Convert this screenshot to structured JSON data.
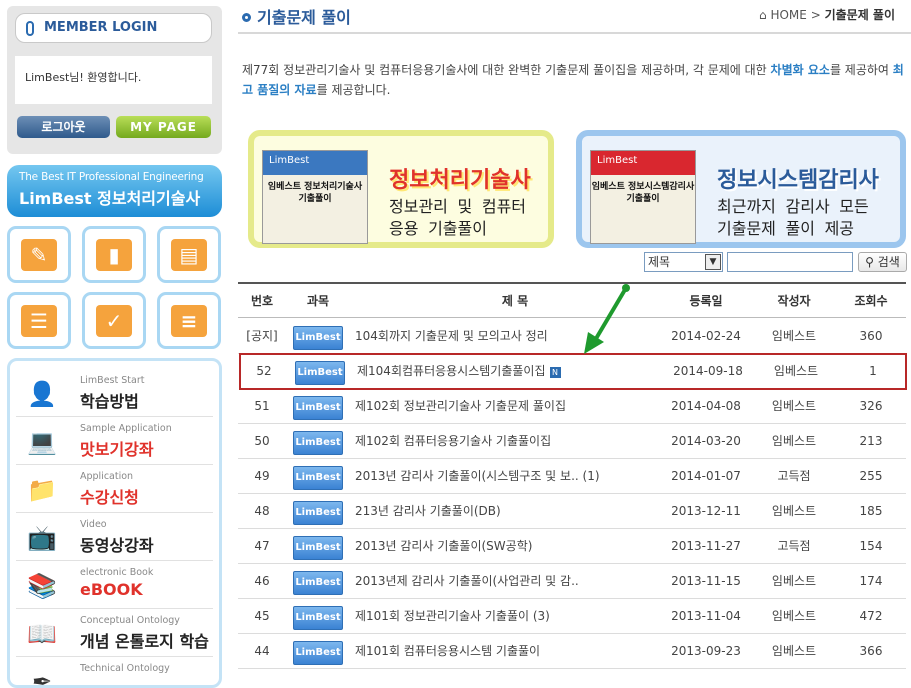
{
  "sidebar": {
    "login_title": "MEMBER LOGIN",
    "welcome": "LimBest님! 환영합니다.",
    "logout_label": "로그아웃",
    "mypage_label": "MY PAGE",
    "banner_sub": "The Best IT Professional Engineering",
    "banner_main": "LimBest 정보처리기술사",
    "tiles": [
      "pencil-icon",
      "chart-icon",
      "book-icon",
      "list-icon",
      "check-icon",
      "menu-list-icon"
    ],
    "menu": [
      {
        "sub": "LimBest Start",
        "main": "학습방법",
        "red": false,
        "icon": "person-icon"
      },
      {
        "sub": "Sample Application",
        "main": "맛보기강좌",
        "red": true,
        "icon": "laptop-icon"
      },
      {
        "sub": "Application",
        "main": "수강신청",
        "red": true,
        "icon": "folder-icon"
      },
      {
        "sub": "Video",
        "main": "동영상강좌",
        "red": false,
        "icon": "tv-icon"
      },
      {
        "sub": "electronic Book",
        "main": "eBOOK",
        "red": true,
        "icon": "books-icon"
      },
      {
        "sub": "Conceptual Ontology",
        "main": "개념 온톨로지 학습",
        "red": false,
        "icon": "open-book-icon"
      },
      {
        "sub": "Technical Ontology",
        "main": "",
        "red": false,
        "icon": "pen-icon"
      }
    ]
  },
  "header": {
    "title": "기출문제 풀이",
    "crumb_home": "HOME",
    "crumb_sep": ">",
    "crumb_current": "기출문제 풀이"
  },
  "intro": {
    "part1": "제77회 정보관리기술사 및 컴퓨터응용기술사에 대한 완벽한 기출문제 풀이집을 제공하며, 각 문제에 대한 ",
    "hl1": "차별화 요소",
    "part2": "를 제공하여 ",
    "hl2": "최고 품질의 자료",
    "part3": "를 제공합니다."
  },
  "promos": [
    {
      "title": "정보처리기술사",
      "desc1": "정보관리 및 컴퓨터",
      "desc2": "응용 기출풀이",
      "book_head": "LimBest",
      "book_title": "임베스트 정보처리기술사 기출풀이"
    },
    {
      "title": "정보시스템감리사",
      "desc1": "최근까지 감리사 모든",
      "desc2": "기출문제 풀이 제공",
      "book_head": "LimBest",
      "book_title": "임베스트 정보시스템감리사 기출풀이"
    }
  ],
  "search": {
    "field": "제목",
    "button": "검색"
  },
  "table": {
    "headers": {
      "no": "번호",
      "cat": "과목",
      "title": "제 목",
      "date": "등록일",
      "writer": "작성자",
      "views": "조회수"
    },
    "rows": [
      {
        "no": "[공지]",
        "cat": "LimBest",
        "title": "104회까지 기출문제 및 모의고사 정리",
        "date": "2014-02-24",
        "writer": "임베스트",
        "views": "360",
        "new": false
      },
      {
        "no": "52",
        "cat": "LimBest",
        "title": "제104회컴퓨터응용시스템기출풀이집",
        "date": "2014-09-18",
        "writer": "임베스트",
        "views": "1",
        "new": true,
        "new_label": "N"
      },
      {
        "no": "51",
        "cat": "LimBest",
        "title": "제102회 정보관리기술사 기출문제 풀이집",
        "date": "2014-04-08",
        "writer": "임베스트",
        "views": "326",
        "new": false
      },
      {
        "no": "50",
        "cat": "LimBest",
        "title": "제102회 컴퓨터응용기술사 기출풀이집",
        "date": "2014-03-20",
        "writer": "임베스트",
        "views": "213",
        "new": false
      },
      {
        "no": "49",
        "cat": "LimBest",
        "title": "2013년 감리사 기출풀이(시스템구조 및 보.. (1)",
        "date": "2014-01-07",
        "writer": "고득점",
        "views": "255",
        "new": false
      },
      {
        "no": "48",
        "cat": "LimBest",
        "title": "213년 감리사 기출풀이(DB)",
        "date": "2013-12-11",
        "writer": "임베스트",
        "views": "185",
        "new": false
      },
      {
        "no": "47",
        "cat": "LimBest",
        "title": "2013년 감리사 기출풀이(SW공학)",
        "date": "2013-11-27",
        "writer": "고득점",
        "views": "154",
        "new": false
      },
      {
        "no": "46",
        "cat": "LimBest",
        "title": "2013년제 감리사 기출풀이(사업관리 및 감..",
        "date": "2013-11-15",
        "writer": "임베스트",
        "views": "174",
        "new": false
      },
      {
        "no": "45",
        "cat": "LimBest",
        "title": "제101회 정보관리기술사 기출풀이 (3)",
        "date": "2013-11-04",
        "writer": "임베스트",
        "views": "472",
        "new": false
      },
      {
        "no": "44",
        "cat": "LimBest",
        "title": "제101회 컴퓨터응용시스템 기출풀이",
        "date": "2013-09-23",
        "writer": "임베스트",
        "views": "366",
        "new": false
      }
    ]
  }
}
